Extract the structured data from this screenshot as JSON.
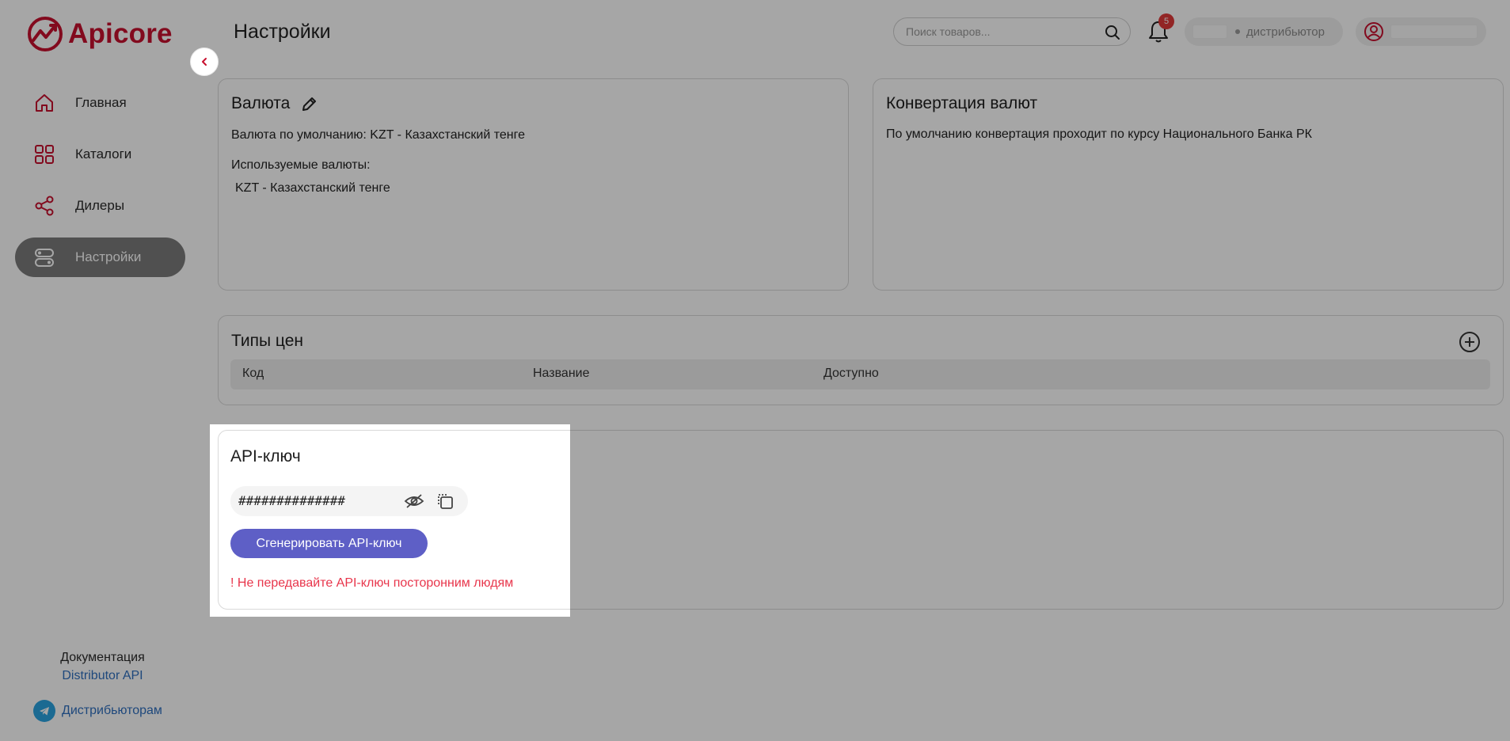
{
  "brand": {
    "name": "Apicore",
    "color": "#c8102e"
  },
  "sidebar": {
    "items": [
      {
        "label": "Главная",
        "icon": "home-icon"
      },
      {
        "label": "Каталоги",
        "icon": "grid-icon"
      },
      {
        "label": "Дилеры",
        "icon": "share-icon"
      },
      {
        "label": "Настройки",
        "icon": "toggle-settings-icon",
        "active": true
      }
    ],
    "docs_title": "Документация",
    "docs_link": "Distributor API",
    "telegram_label": "Дистрибьюторам"
  },
  "header": {
    "title": "Настройки",
    "search_placeholder": "Поиск товаров...",
    "notifications_count": "5",
    "role_label": "дистрибьютор"
  },
  "currency_card": {
    "title": "Валюта",
    "default_line": "Валюта по умолчанию: KZT - Казахстанский тенге",
    "used_title": "Используемые валюты:",
    "used_list": "KZT - Казахстанский тенге"
  },
  "conversion_card": {
    "title": "Конвертация валют",
    "text": "По умолчанию конвертация проходит по курсу Национального Банка РК"
  },
  "price_types_card": {
    "title": "Типы цен",
    "columns": [
      "Код",
      "Название",
      "Доступно"
    ]
  },
  "api_card": {
    "title": "API-ключ",
    "masked_key": "##############",
    "generate_label": "Сгенерировать API-ключ",
    "warning": "! Не передавайте API-ключ посторонним людям",
    "button_color": "#5e5fc6",
    "warning_color": "#e8354b"
  }
}
